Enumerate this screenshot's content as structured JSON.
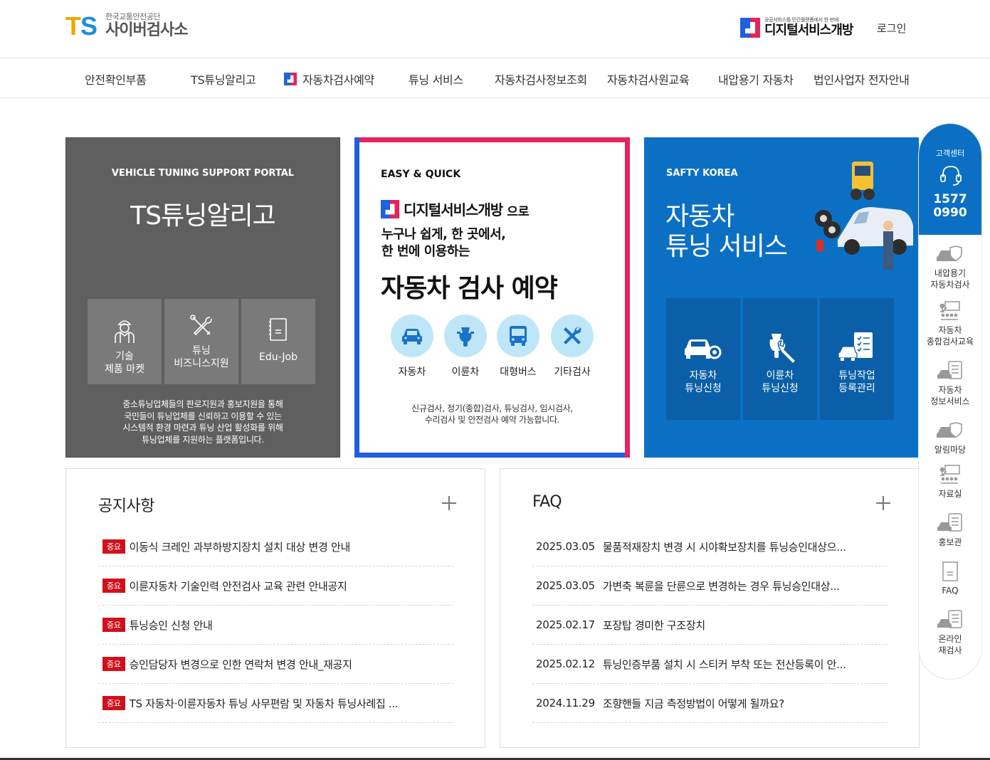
{
  "header": {
    "logo_mark": "TS",
    "logo_sub": "한국교통안전공단",
    "logo_main": "사이버검사소",
    "dsb_tagline": "공공서비스를 민간플랫폼에서 한 번에",
    "dsb_name": "디지털서비스개방",
    "login": "로그인"
  },
  "nav": {
    "items": [
      "안전확인부품",
      "TS튜닝알리고",
      "자동차검사예약",
      "튜닝 서비스",
      "자동차검사정보조회",
      "자동차검사원교육",
      "내압용기 자동차",
      "법인사업자 전자안내"
    ]
  },
  "card_tuning": {
    "eng": "VEHICLE TUNING SUPPORT PORTAL",
    "title": "TS튜닝알리고",
    "tiles": [
      {
        "line1": "기술",
        "line2": "제품 마켓",
        "icon": "worker-icon"
      },
      {
        "line1": "튜닝",
        "line2": "비즈니스지원",
        "icon": "tools-icon"
      },
      {
        "line1": "Edu-Job",
        "line2": "",
        "icon": "document-icon"
      }
    ],
    "desc": [
      "중소튜닝업체들의 판로지원과 홍보지원을 통해",
      "국민들이 튜닝업체를 신뢰하고 이용할 수 있는",
      "시스템적 환경 마련과 튜닝 산업 활성화를 위해",
      "튜닝업체를 지원하는 플랫폼입니다."
    ]
  },
  "card_reserve": {
    "eq": "EASY & QUICK",
    "dsb_name": "디지털서비스개방",
    "ro": "으로",
    "line1": "누구나 쉽게, 한 곳에서,",
    "line2": "한 번에 이용하는",
    "big": "자동차 검사 예약",
    "circles": [
      {
        "label": "자동차",
        "icon": "car-icon"
      },
      {
        "label": "이륜차",
        "icon": "scooter-icon"
      },
      {
        "label": "대형버스",
        "icon": "bus-icon"
      },
      {
        "label": "기타검사",
        "icon": "wrench-icon"
      }
    ],
    "note1": "신규검사, 정기(종합)검사, 튜닝검사, 임시검사,",
    "note2": "수리검사 및 안전검사 예약 가능합니다."
  },
  "card_service": {
    "eng": "SAFTY KOREA",
    "t1": "자동차",
    "t2": "튜닝 서비스",
    "tiles": [
      {
        "line1": "자동차",
        "line2": "튜닝신청",
        "icon": "car-gear-icon"
      },
      {
        "line1": "이륜차",
        "line2": "튜닝신청",
        "icon": "scooter-wrench-icon"
      },
      {
        "line1": "튜닝작업",
        "line2": "등록관리",
        "icon": "checklist-car-icon"
      }
    ]
  },
  "notice": {
    "title": "공지사항",
    "tag": "중요",
    "rows": [
      "이동식 크레인 과부하방지장치 설치 대상 변경 안내",
      "이륜자동차 기술인력 안전검사 교육 관련 안내공지",
      "튜닝승인 신청 안내",
      "승인담당자 변경으로 인한 연락처 변경 안내_재공지",
      "TS 자동차·이륜자동차 튜닝 사무편람 및 자동차 튜닝사례집 ..."
    ]
  },
  "faq": {
    "title": "FAQ",
    "rows": [
      {
        "date": "2025.03.05",
        "text": "물품적재장치 변경 시 시야확보장치를 튜닝승인대상으..."
      },
      {
        "date": "2025.03.05",
        "text": "가변축 복륜을 단륜으로 변경하는 경우 튜닝승인대상..."
      },
      {
        "date": "2025.02.17",
        "text": "포장탑 경미한 구조장치"
      },
      {
        "date": "2025.02.12",
        "text": "튜닝인증부품 설치 시 스티커 부착 또는 전산등록이 안..."
      },
      {
        "date": "2024.11.29",
        "text": "조향핸들 지금 측정방법이 어떻게 될까요?"
      }
    ]
  },
  "quick": {
    "cs": "고객센터",
    "num1": "1577",
    "num2": "0990",
    "items": [
      {
        "l1": "내압용기",
        "l2": "자동차검사",
        "icon": "car-shield-icon"
      },
      {
        "l1": "자동차",
        "l2": "종합검사교육",
        "icon": "classroom-icon"
      },
      {
        "l1": "자동차",
        "l2": "정보서비스",
        "icon": "car-clipboard-icon"
      },
      {
        "l1": "알림마당",
        "l2": "",
        "icon": "car-shield-icon"
      },
      {
        "l1": "자료실",
        "l2": "",
        "icon": "classroom-icon"
      },
      {
        "l1": "홍보관",
        "l2": "",
        "icon": "car-clipboard-icon"
      },
      {
        "l1": "FAQ",
        "l2": "",
        "icon": "document-icon"
      },
      {
        "l1": "온라인",
        "l2": "재검사",
        "icon": "car-clipboard-icon"
      }
    ]
  },
  "colors": {
    "ts_orange": "#f5a200",
    "ts_blue": "#1b8fd6",
    "card_gray": "#5f5f5f",
    "brand_blue": "#0b70c4",
    "accent_red": "#e4245a",
    "accent_blue": "#1f5fe0",
    "tag_red": "#d0111b",
    "circle_bg": "#bfe6f8"
  }
}
